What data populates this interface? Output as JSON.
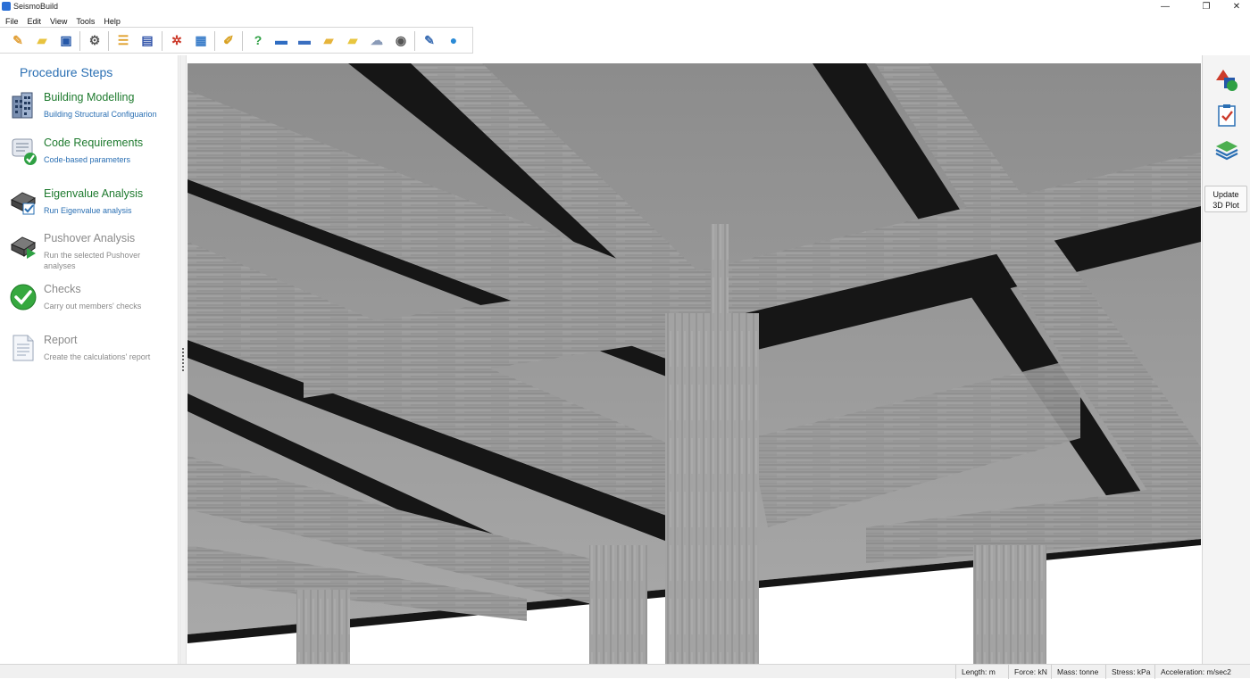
{
  "window": {
    "title": "SeismoBuild",
    "minimize_glyph": "—",
    "restore_glyph": "❐",
    "close_glyph": "✕"
  },
  "menu": [
    "File",
    "Edit",
    "View",
    "Tools",
    "Help"
  ],
  "toolbar": {
    "buttons": [
      {
        "icon": "new-project-icon",
        "glyph": "✎",
        "color": "#e2a13a"
      },
      {
        "icon": "open-folder-icon",
        "glyph": "▰",
        "color": "#e8c33f"
      },
      {
        "icon": "save-icon",
        "glyph": "▣",
        "color": "#2558a8"
      },
      {
        "icon": "run-analysis-icon",
        "glyph": "⚙",
        "color": "#555555"
      },
      {
        "icon": "building-levels-icon",
        "glyph": "☰",
        "color": "#e0a12e"
      },
      {
        "icon": "member-properties-icon",
        "glyph": "▤",
        "color": "#3355aa"
      },
      {
        "icon": "settings-gear-icon",
        "glyph": "✲",
        "color": "#cc3b2b"
      },
      {
        "icon": "calculator-icon",
        "glyph": "▦",
        "color": "#3a7dc9"
      },
      {
        "icon": "clear-brush-icon",
        "glyph": "✐",
        "color": "#d8a020"
      },
      {
        "icon": "help-icon",
        "glyph": "?",
        "color": "#2ea043"
      },
      {
        "icon": "manual-book-icon",
        "glyph": "▬",
        "color": "#2f6dc2"
      },
      {
        "icon": "tutorial-book-icon",
        "glyph": "▬",
        "color": "#3b6fc0"
      },
      {
        "icon": "examples-folder-icon",
        "glyph": "▰",
        "color": "#e6b43b"
      },
      {
        "icon": "notes-folder-icon",
        "glyph": "▰",
        "color": "#e8c63f"
      },
      {
        "icon": "feedback-chat-icon",
        "glyph": "☁",
        "color": "#8a9bb8"
      },
      {
        "icon": "video-tutorial-icon",
        "glyph": "◉",
        "color": "#555555"
      },
      {
        "icon": "edit-notes-icon",
        "glyph": "✎",
        "color": "#3d6fb4"
      },
      {
        "icon": "web-globe-icon",
        "glyph": "●",
        "color": "#2a8ad6"
      }
    ]
  },
  "sidebar": {
    "title": "Procedure Steps",
    "steps": [
      {
        "label": "Building Modelling",
        "desc": "Building Structural Configuarion",
        "state": "enabled",
        "icon": "building-icon"
      },
      {
        "label": "Code Requirements",
        "desc": "Code-based parameters",
        "state": "enabled",
        "icon": "code-scroll-icon"
      },
      {
        "label": "Eigenvalue Analysis",
        "desc": "Run Eigenvalue analysis",
        "state": "enabled",
        "icon": "eigenvalue-icon"
      },
      {
        "label": "Pushover Analysis",
        "desc": "Run the selected Pushover analyses",
        "state": "disabled",
        "icon": "pushover-icon"
      },
      {
        "label": "Checks",
        "desc": "Carry out members' checks",
        "state": "disabled",
        "icon": "check-mark-icon"
      },
      {
        "label": "Report",
        "desc": "Create the calculations' report",
        "state": "disabled",
        "icon": "report-document-icon"
      }
    ]
  },
  "right_panel": {
    "tools": [
      "shapes-icon",
      "checklist-icon",
      "layers-icon"
    ],
    "update_label_line1": "Update",
    "update_label_line2": "3D Plot"
  },
  "status_bar": {
    "length": "Length: m",
    "force": "Force: kN",
    "mass": "Mass: tonne",
    "stress": "Stress: kPa",
    "acceleration": "Acceleration: m/sec2"
  },
  "colors": {
    "accent_blue": "#2a6fb3",
    "step_green": "#1e7a2e",
    "disabled_gray": "#8a8a8a",
    "concrete": "#8f8f8f",
    "beam_shadow": "#161616"
  }
}
